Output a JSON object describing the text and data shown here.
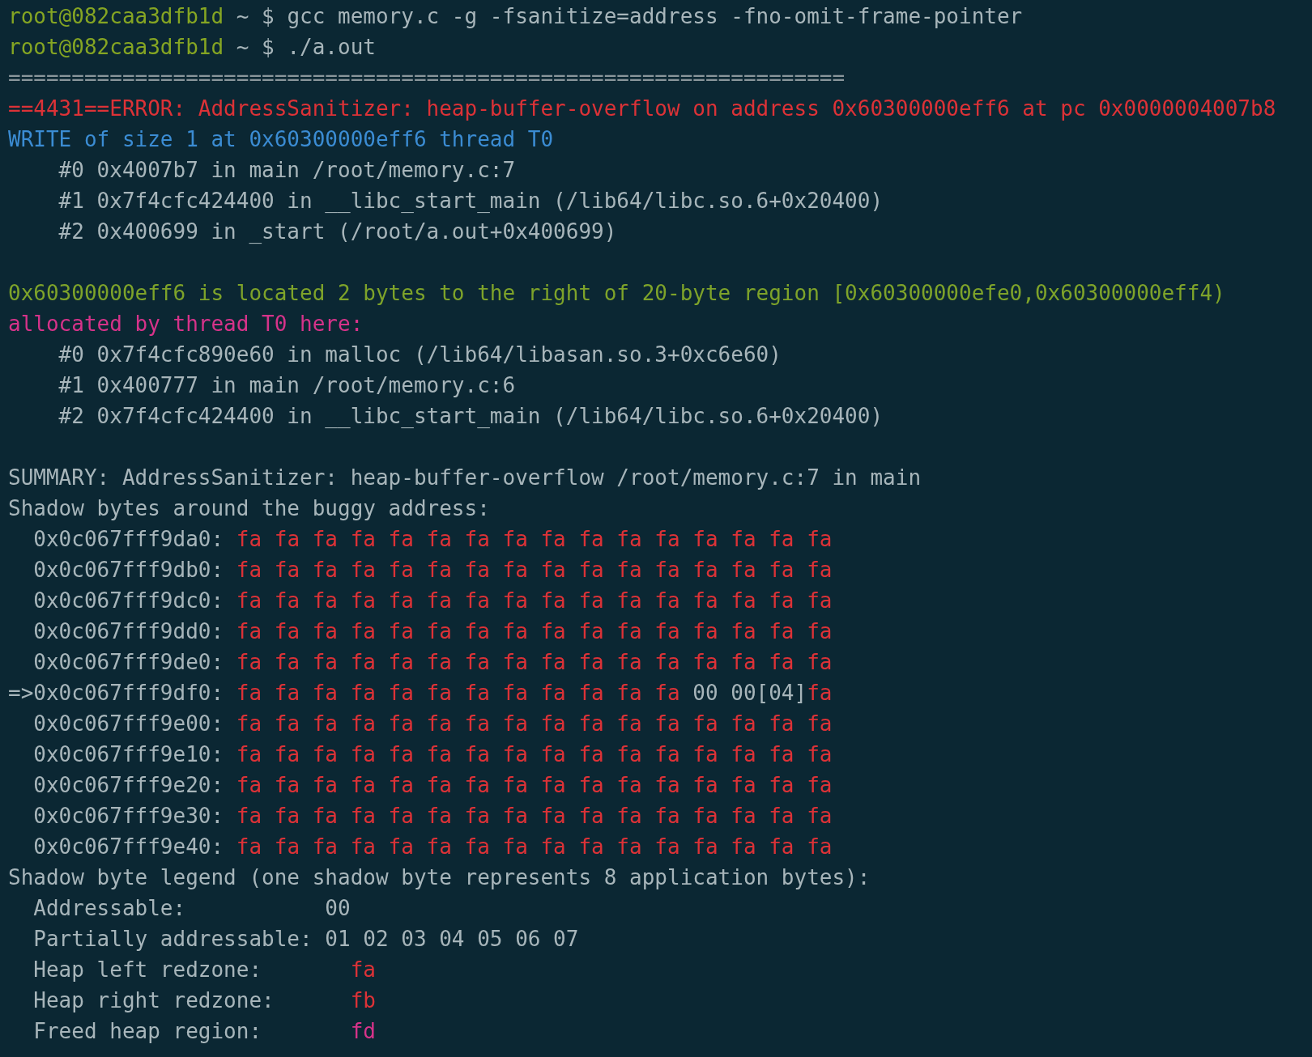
{
  "lines": [
    {
      "kind": "text",
      "segments": [
        {
          "text": "root@082caa3dfb1d",
          "color": "#85a523"
        },
        {
          "text": " ~ $ gcc memory.c -g -fsanitize=address -fno-omit-frame-pointer",
          "color": "#a7b5ba"
        }
      ]
    },
    {
      "kind": "text",
      "segments": [
        {
          "text": "root@082caa3dfb1d",
          "color": "#85a523"
        },
        {
          "text": " ~ $ ./a.out",
          "color": "#a7b5ba"
        }
      ]
    },
    {
      "kind": "text",
      "segments": [
        {
          "text": "==================================================================",
          "color": "#8a969b"
        }
      ]
    },
    {
      "kind": "text",
      "segments": [
        {
          "text": "==4431==ERROR: AddressSanitizer: heap-buffer-overflow on address 0x60300000eff6 at pc 0x0000004007b8",
          "color": "#dc3237"
        }
      ]
    },
    {
      "kind": "text",
      "segments": [
        {
          "text": "WRITE of size 1 at 0x60300000eff6 thread T0",
          "color": "#3b8cd3"
        }
      ]
    },
    {
      "kind": "text",
      "segments": [
        {
          "text": "    #0 0x4007b7 in main /root/memory.c:7",
          "color": "#a7b5ba"
        }
      ]
    },
    {
      "kind": "text",
      "segments": [
        {
          "text": "    #1 0x7f4cfc424400 in __libc_start_main (/lib64/libc.so.6+0x20400)",
          "color": "#a7b5ba"
        }
      ]
    },
    {
      "kind": "text",
      "segments": [
        {
          "text": "    #2 0x400699 in _start (/root/a.out+0x400699)",
          "color": "#a7b5ba"
        }
      ]
    },
    {
      "kind": "blank"
    },
    {
      "kind": "text",
      "segments": [
        {
          "text": "0x60300000eff6 is located 2 bytes to the right of 20-byte region [0x60300000efe0,0x60300000eff4)",
          "color": "#7ea32a"
        }
      ]
    },
    {
      "kind": "text",
      "segments": [
        {
          "text": "allocated by thread T0 here:",
          "color": "#d6338a"
        }
      ]
    },
    {
      "kind": "text",
      "segments": [
        {
          "text": "    #0 0x7f4cfc890e60 in malloc (/lib64/libasan.so.3+0xc6e60)",
          "color": "#a7b5ba"
        }
      ]
    },
    {
      "kind": "text",
      "segments": [
        {
          "text": "    #1 0x400777 in main /root/memory.c:6",
          "color": "#a7b5ba"
        }
      ]
    },
    {
      "kind": "text",
      "segments": [
        {
          "text": "    #2 0x7f4cfc424400 in __libc_start_main (/lib64/libc.so.6+0x20400)",
          "color": "#a7b5ba"
        }
      ]
    },
    {
      "kind": "blank"
    },
    {
      "kind": "text",
      "segments": [
        {
          "text": "SUMMARY: AddressSanitizer: heap-buffer-overflow /root/memory.c:7 in main",
          "color": "#a7b5ba"
        }
      ]
    },
    {
      "kind": "text",
      "segments": [
        {
          "text": "Shadow bytes around the buggy address:",
          "color": "#a7b5ba"
        }
      ]
    },
    {
      "kind": "text",
      "segments": [
        {
          "text": "  0x0c067fff9da0: ",
          "color": "#a7b5ba"
        },
        {
          "text": "fa fa fa fa fa fa fa fa fa fa fa fa fa fa fa fa",
          "color": "#dc3237"
        }
      ]
    },
    {
      "kind": "text",
      "segments": [
        {
          "text": "  0x0c067fff9db0: ",
          "color": "#a7b5ba"
        },
        {
          "text": "fa fa fa fa fa fa fa fa fa fa fa fa fa fa fa fa",
          "color": "#dc3237"
        }
      ]
    },
    {
      "kind": "text",
      "segments": [
        {
          "text": "  0x0c067fff9dc0: ",
          "color": "#a7b5ba"
        },
        {
          "text": "fa fa fa fa fa fa fa fa fa fa fa fa fa fa fa fa",
          "color": "#dc3237"
        }
      ]
    },
    {
      "kind": "text",
      "segments": [
        {
          "text": "  0x0c067fff9dd0: ",
          "color": "#a7b5ba"
        },
        {
          "text": "fa fa fa fa fa fa fa fa fa fa fa fa fa fa fa fa",
          "color": "#dc3237"
        }
      ]
    },
    {
      "kind": "text",
      "segments": [
        {
          "text": "  0x0c067fff9de0: ",
          "color": "#a7b5ba"
        },
        {
          "text": "fa fa fa fa fa fa fa fa fa fa fa fa fa fa fa fa",
          "color": "#dc3237"
        }
      ]
    },
    {
      "kind": "text",
      "segments": [
        {
          "text": "=>0x0c067fff9df0: ",
          "color": "#a7b5ba"
        },
        {
          "text": "fa fa fa fa fa fa fa fa fa fa fa fa",
          "color": "#dc3237"
        },
        {
          "text": " 00 00[04]",
          "color": "#a7b5ba"
        },
        {
          "text": "fa",
          "color": "#dc3237"
        }
      ]
    },
    {
      "kind": "text",
      "segments": [
        {
          "text": "  0x0c067fff9e00: ",
          "color": "#a7b5ba"
        },
        {
          "text": "fa fa fa fa fa fa fa fa fa fa fa fa fa fa fa fa",
          "color": "#dc3237"
        }
      ]
    },
    {
      "kind": "text",
      "segments": [
        {
          "text": "  0x0c067fff9e10: ",
          "color": "#a7b5ba"
        },
        {
          "text": "fa fa fa fa fa fa fa fa fa fa fa fa fa fa fa fa",
          "color": "#dc3237"
        }
      ]
    },
    {
      "kind": "text",
      "segments": [
        {
          "text": "  0x0c067fff9e20: ",
          "color": "#a7b5ba"
        },
        {
          "text": "fa fa fa fa fa fa fa fa fa fa fa fa fa fa fa fa",
          "color": "#dc3237"
        }
      ]
    },
    {
      "kind": "text",
      "segments": [
        {
          "text": "  0x0c067fff9e30: ",
          "color": "#a7b5ba"
        },
        {
          "text": "fa fa fa fa fa fa fa fa fa fa fa fa fa fa fa fa",
          "color": "#dc3237"
        }
      ]
    },
    {
      "kind": "text",
      "segments": [
        {
          "text": "  0x0c067fff9e40: ",
          "color": "#a7b5ba"
        },
        {
          "text": "fa fa fa fa fa fa fa fa fa fa fa fa fa fa fa fa",
          "color": "#dc3237"
        }
      ]
    },
    {
      "kind": "text",
      "segments": [
        {
          "text": "Shadow byte legend (one shadow byte represents 8 application bytes):",
          "color": "#a7b5ba"
        }
      ]
    },
    {
      "kind": "text",
      "segments": [
        {
          "text": "  Addressable:           00",
          "color": "#a7b5ba"
        }
      ]
    },
    {
      "kind": "text",
      "segments": [
        {
          "text": "  Partially addressable: 01 02 03 04 05 06 07",
          "color": "#a7b5ba"
        }
      ]
    },
    {
      "kind": "text",
      "segments": [
        {
          "text": "  Heap left redzone:       ",
          "color": "#a7b5ba"
        },
        {
          "text": "fa",
          "color": "#dc3237"
        }
      ]
    },
    {
      "kind": "text",
      "segments": [
        {
          "text": "  Heap right redzone:      ",
          "color": "#a7b5ba"
        },
        {
          "text": "fb",
          "color": "#dc3237"
        }
      ]
    },
    {
      "kind": "text",
      "segments": [
        {
          "text": "  Freed heap region:       ",
          "color": "#a7b5ba"
        },
        {
          "text": "fd",
          "color": "#d6338a"
        }
      ]
    }
  ]
}
